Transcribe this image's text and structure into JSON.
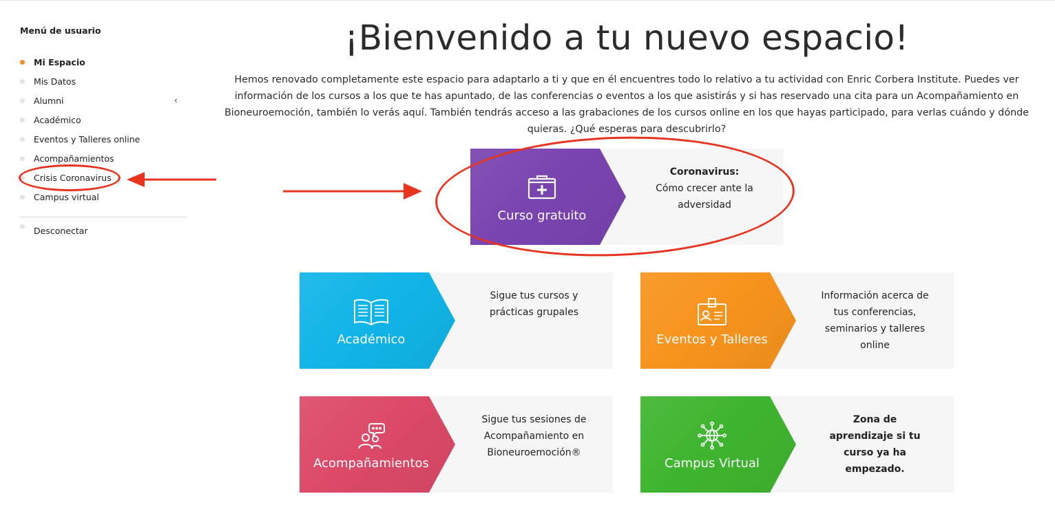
{
  "sidebar": {
    "title": "Menú de usuario",
    "items": [
      {
        "label": "Mi Espacio",
        "active": true
      },
      {
        "label": "Mis Datos"
      },
      {
        "label": "Alumni",
        "chevron": "‹"
      },
      {
        "label": "Académico"
      },
      {
        "label": "Eventos y Talleres online"
      },
      {
        "label": "Acompañamientos"
      },
      {
        "label": "Crisis Coronavirus"
      },
      {
        "label": "Campus virtual"
      }
    ],
    "logout": "Desconectar"
  },
  "main": {
    "title": "¡Bienvenido a tu nuevo espacio!",
    "intro": "Hemos renovado completamente este espacio para adaptarlo a ti y que en él encuentres todo lo relativo a tu actividad con Enric Corbera Institute. Puedes ver información de los cursos a los que te has apuntado, de las conferencias o eventos a los que asistirás y si has reservado una cita para un Acompañamiento en Bioneuroemoción, también lo verás aquí. También tendrás acceso a las grabaciones de los cursos online en los que hayas participado, para verlas cuándo y dónde quieras. ¿Qué esperas para descubrirlo?"
  },
  "cards": {
    "feature": {
      "label": "Curso gratuito",
      "desc_bold": "Coronavirus:",
      "desc": "Cómo crecer ante la adversidad",
      "color": "#7a44b0",
      "icon": "medical-kit-icon"
    },
    "academico": {
      "label": "Académico",
      "desc": "Sigue tus cursos y prácticas grupales",
      "color": "#11b5e8",
      "icon": "open-book-icon"
    },
    "eventos": {
      "label": "Eventos y Talleres",
      "desc": "Información acerca de tus conferencias, seminarios y talleres online",
      "color": "#f7941d",
      "icon": "id-badge-icon"
    },
    "acompanamientos": {
      "label": "Acompañamientos",
      "desc": "Sigue tus sesiones de Acompañamiento en Bioneuroemoción®",
      "color": "#dc4a68",
      "icon": "people-chat-icon"
    },
    "campus": {
      "label": "Campus Virtual",
      "desc": "Zona de aprendizaje si tu curso ya ha empezado.",
      "color": "#3fb52f",
      "icon": "network-globe-icon"
    }
  },
  "annotations": {
    "color": "#e8341f"
  }
}
